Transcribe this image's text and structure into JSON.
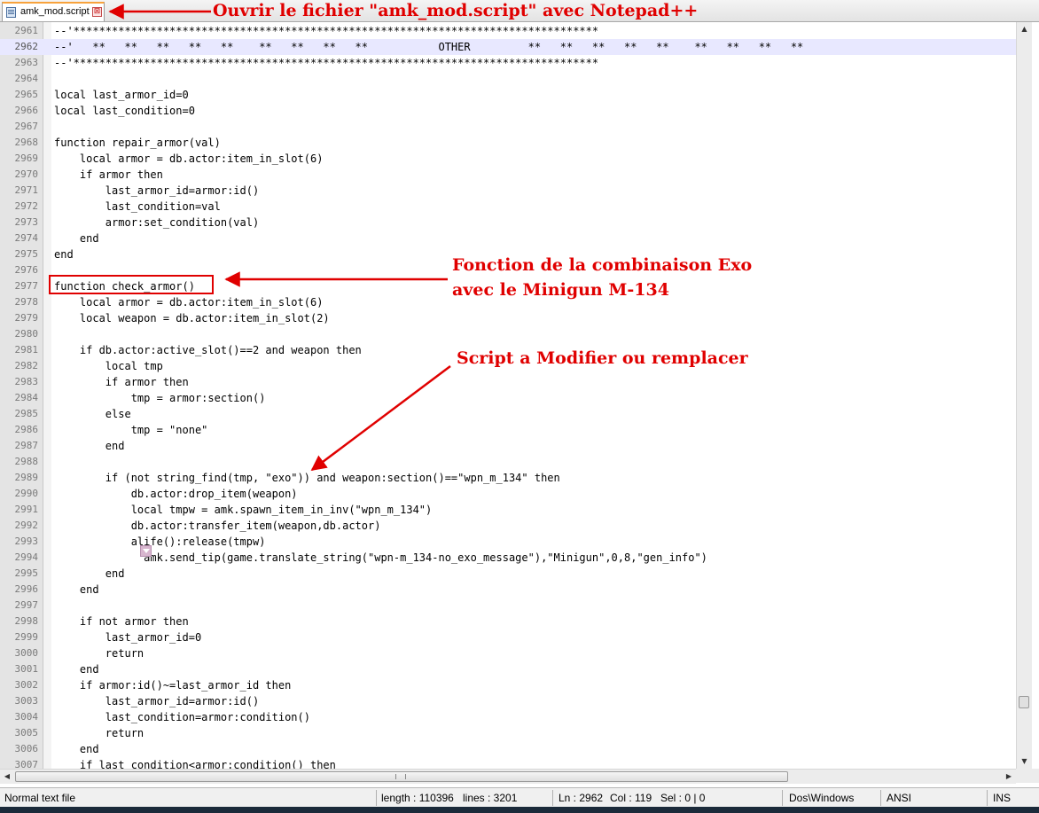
{
  "tab": {
    "label": "amk_mod.script",
    "close_glyph": "⊠",
    "icon": "document-icon"
  },
  "editor": {
    "current_line": "2962",
    "bookmark_icon": "fold-marker-icon",
    "lines": [
      {
        "n": "2961",
        "text": "--'**********************************************************************************"
      },
      {
        "n": "2962",
        "text": "--'   **   **   **   **   **    **   **   **   **           OTHER         **   **   **   **   **    **   **   **   **"
      },
      {
        "n": "2963",
        "text": "--'**********************************************************************************"
      },
      {
        "n": "2964",
        "text": ""
      },
      {
        "n": "2965",
        "text": "local last_armor_id=0"
      },
      {
        "n": "2966",
        "text": "local last_condition=0"
      },
      {
        "n": "2967",
        "text": ""
      },
      {
        "n": "2968",
        "text": "function repair_armor(val)"
      },
      {
        "n": "2969",
        "text": "    local armor = db.actor:item_in_slot(6)"
      },
      {
        "n": "2970",
        "text": "    if armor then"
      },
      {
        "n": "2971",
        "text": "        last_armor_id=armor:id()"
      },
      {
        "n": "2972",
        "text": "        last_condition=val"
      },
      {
        "n": "2973",
        "text": "        armor:set_condition(val)"
      },
      {
        "n": "2974",
        "text": "    end"
      },
      {
        "n": "2975",
        "text": "end"
      },
      {
        "n": "2976",
        "text": ""
      },
      {
        "n": "2977",
        "text": "function check_armor()"
      },
      {
        "n": "2978",
        "text": "    local armor = db.actor:item_in_slot(6)"
      },
      {
        "n": "2979",
        "text": "    local weapon = db.actor:item_in_slot(2)"
      },
      {
        "n": "2980",
        "text": ""
      },
      {
        "n": "2981",
        "text": "    if db.actor:active_slot()==2 and weapon then"
      },
      {
        "n": "2982",
        "text": "        local tmp"
      },
      {
        "n": "2983",
        "text": "        if armor then"
      },
      {
        "n": "2984",
        "text": "            tmp = armor:section()"
      },
      {
        "n": "2985",
        "text": "        else"
      },
      {
        "n": "2986",
        "text": "            tmp = \"none\""
      },
      {
        "n": "2987",
        "text": "        end"
      },
      {
        "n": "2988",
        "text": ""
      },
      {
        "n": "2989",
        "text": "        if (not string_find(tmp, \"exo\")) and weapon:section()==\"wpn_m_134\" then"
      },
      {
        "n": "2990",
        "text": "            db.actor:drop_item(weapon)"
      },
      {
        "n": "2991",
        "text": "            local tmpw = amk.spawn_item_in_inv(\"wpn_m_134\")"
      },
      {
        "n": "2992",
        "text": "            db.actor:transfer_item(weapon,db.actor)"
      },
      {
        "n": "2993",
        "text": "            alife():release(tmpw)"
      },
      {
        "n": "2994",
        "text": "              amk.send_tip(game.translate_string(\"wpn-m_134-no_exo_message\"),\"Minigun\",0,8,\"gen_info\")"
      },
      {
        "n": "2995",
        "text": "        end"
      },
      {
        "n": "2996",
        "text": "    end"
      },
      {
        "n": "2997",
        "text": ""
      },
      {
        "n": "2998",
        "text": "    if not armor then"
      },
      {
        "n": "2999",
        "text": "        last_armor_id=0"
      },
      {
        "n": "3000",
        "text": "        return"
      },
      {
        "n": "3001",
        "text": "    end"
      },
      {
        "n": "3002",
        "text": "    if armor:id()~=last_armor_id then"
      },
      {
        "n": "3003",
        "text": "        last_armor_id=armor:id()"
      },
      {
        "n": "3004",
        "text": "        last_condition=armor:condition()"
      },
      {
        "n": "3005",
        "text": "        return"
      },
      {
        "n": "3006",
        "text": "    end"
      },
      {
        "n": "3007",
        "text": "    if last_condition<armor:condition() then"
      }
    ]
  },
  "scrollbars": {
    "up": "▲",
    "down": "▼",
    "left": "◀",
    "right": "▶"
  },
  "status": {
    "file_type": "Normal text file",
    "length": "length : 110396",
    "lines": "lines : 3201",
    "ln": "Ln : 2962",
    "col": "Col : 119",
    "sel": "Sel : 0 | 0",
    "eol": "Dos\\Windows",
    "encoding": "ANSI",
    "mode": "INS"
  },
  "annotations": {
    "open_file": "Ouvrir le fichier \"amk_mod.script\" avec Notepad++",
    "fonction_line1": "Fonction de la combinaison Exo",
    "fonction_line2": "avec le Minigun M-134",
    "script_modify": "Script a Modifier ou remplacer",
    "color": "#e00000"
  }
}
